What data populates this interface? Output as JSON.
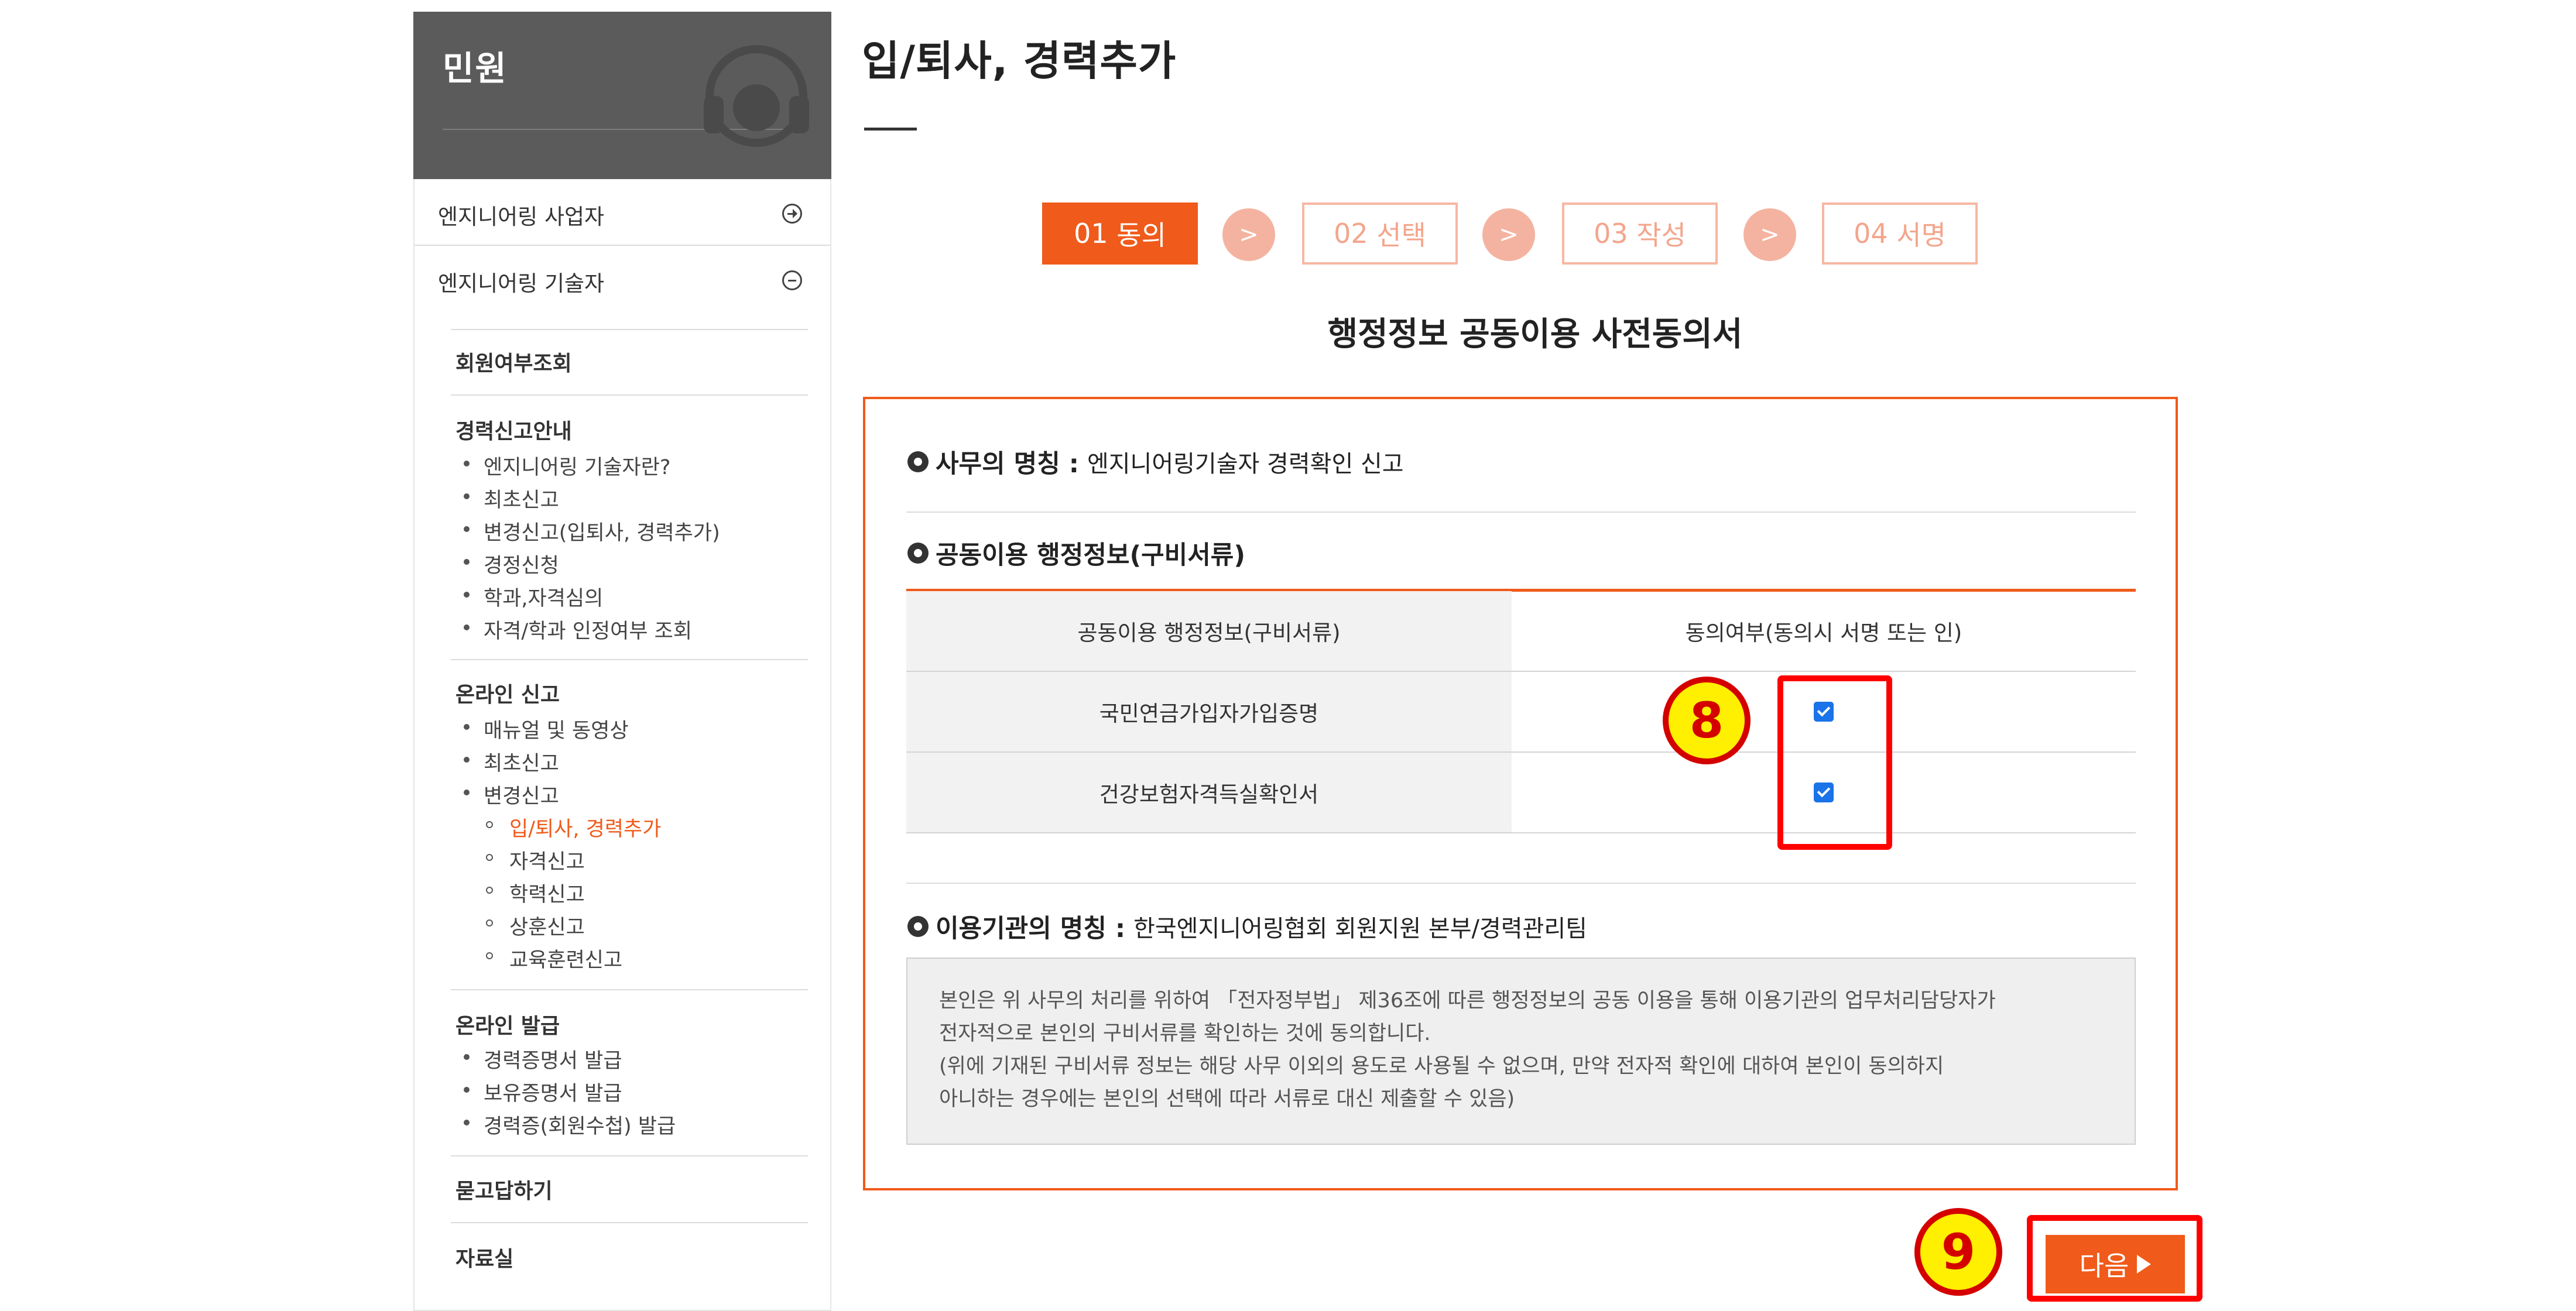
{
  "sidebar": {
    "title": "민원",
    "main_items": [
      {
        "label": "엔지니어링 사업자",
        "icon": "circle-arrow-right-icon"
      },
      {
        "label": "엔지니어링 기술자",
        "icon": "circle-minus-icon"
      }
    ],
    "member_check": "회원여부조회",
    "career_guide": {
      "title": "경력신고안내",
      "items": [
        "엔지니어링 기술자란?",
        "최초신고",
        "변경신고(입퇴사, 경력추가)",
        "경정신청",
        "학과,자격심의",
        "자격/학과 인정여부 조회"
      ]
    },
    "online_report": {
      "title": "온라인 신고",
      "items": [
        "매뉴얼 및 동영상",
        "최초신고",
        "변경신고"
      ],
      "sub_items": [
        "입/퇴사, 경력추가",
        "자격신고",
        "학력신고",
        "상훈신고",
        "교육훈련신고"
      ]
    },
    "online_issue": {
      "title": "온라인 발급",
      "items": [
        "경력증명서 발급",
        "보유증명서 발급",
        "경력증(회원수첩) 발급"
      ]
    },
    "qna": "묻고답하기",
    "archive": "자료실"
  },
  "main": {
    "title": "입/퇴사, 경력추가",
    "steps": [
      {
        "num": "01",
        "label": "동의"
      },
      {
        "num": "02",
        "label": "선택"
      },
      {
        "num": "03",
        "label": "작성"
      },
      {
        "num": "04",
        "label": "서명"
      }
    ],
    "step_arrow": ">",
    "subtitle": "행정정보 공동이용 사전동의서",
    "office_name_label": "사무의 명칭 :",
    "office_name_value": "엔지니어링기술자 경력확인 신고",
    "shared_info_title": "공동이용 행정정보(구비서류)",
    "table": {
      "headers": [
        "공동이용 행정정보(구비서류)",
        "동의여부(동의시 서명 또는 인)"
      ],
      "rows": [
        {
          "label": "국민연금가입자가입증명",
          "checked": true
        },
        {
          "label": "건강보험자격득실확인서",
          "checked": true
        }
      ]
    },
    "agency_label": "이용기관의 명칭 :",
    "agency_value": "한국엔지니어링협회 회원지원 본부/경력관리팀",
    "notice_lines": [
      "본인은 위 사무의 처리를 위하여 「전자정부법」 제36조에 따른 행정정보의 공동 이용을 통해 이용기관의 업무처리담당자가",
      "전자적으로 본인의 구비서류를 확인하는 것에 동의합니다.",
      "(위에 기재된 구비서류 정보는 해당 사무 이외의 용도로 사용될 수 없으며, 만약 전자적 확인에 대하여 본인이 동의하지",
      "아니하는 경우에는 본인의 선택에 따라 서류로 대신 제출할 수 있음)"
    ],
    "next_button": "다음"
  },
  "annotations": {
    "badge_8": "8",
    "badge_9": "9"
  }
}
